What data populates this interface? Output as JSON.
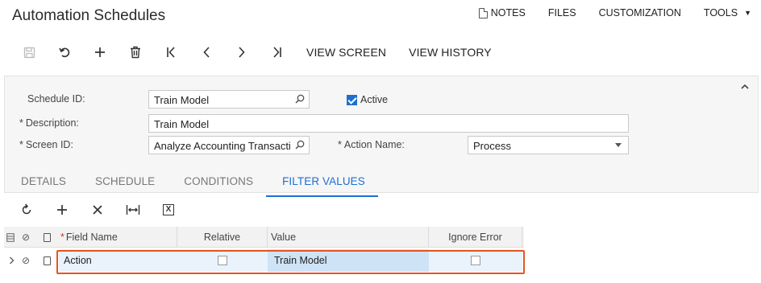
{
  "header": {
    "title": "Automation Schedules",
    "links": {
      "notes": "NOTES",
      "files": "FILES",
      "customization": "CUSTOMIZATION",
      "tools": "TOOLS"
    }
  },
  "toolbar": {
    "view_screen": "VIEW SCREEN",
    "view_history": "VIEW HISTORY"
  },
  "form": {
    "schedule_id_label": "Schedule ID:",
    "schedule_id_value": "Train Model",
    "active_label": "Active",
    "active_checked": true,
    "description_label": "Description:",
    "description_value": "Train Model",
    "screen_id_label": "Screen ID:",
    "screen_id_value": "Analyze Accounting Transacti",
    "action_name_label": "Action Name:",
    "action_name_value": "Process"
  },
  "tabs": [
    "DETAILS",
    "SCHEDULE",
    "CONDITIONS",
    "FILTER VALUES"
  ],
  "active_tab": "FILTER VALUES",
  "grid": {
    "columns": {
      "field_name": "Field Name",
      "relative": "Relative",
      "value": "Value",
      "ignore_error": "Ignore Error"
    },
    "rows": [
      {
        "field_name": "Action",
        "relative": false,
        "value": "Train Model",
        "ignore_error": false
      }
    ]
  },
  "colors": {
    "accent": "#1e6fd0",
    "highlight_border": "#e8541e",
    "selected_cell": "#cfe3f7",
    "row_bg": "#eaf3fc"
  }
}
